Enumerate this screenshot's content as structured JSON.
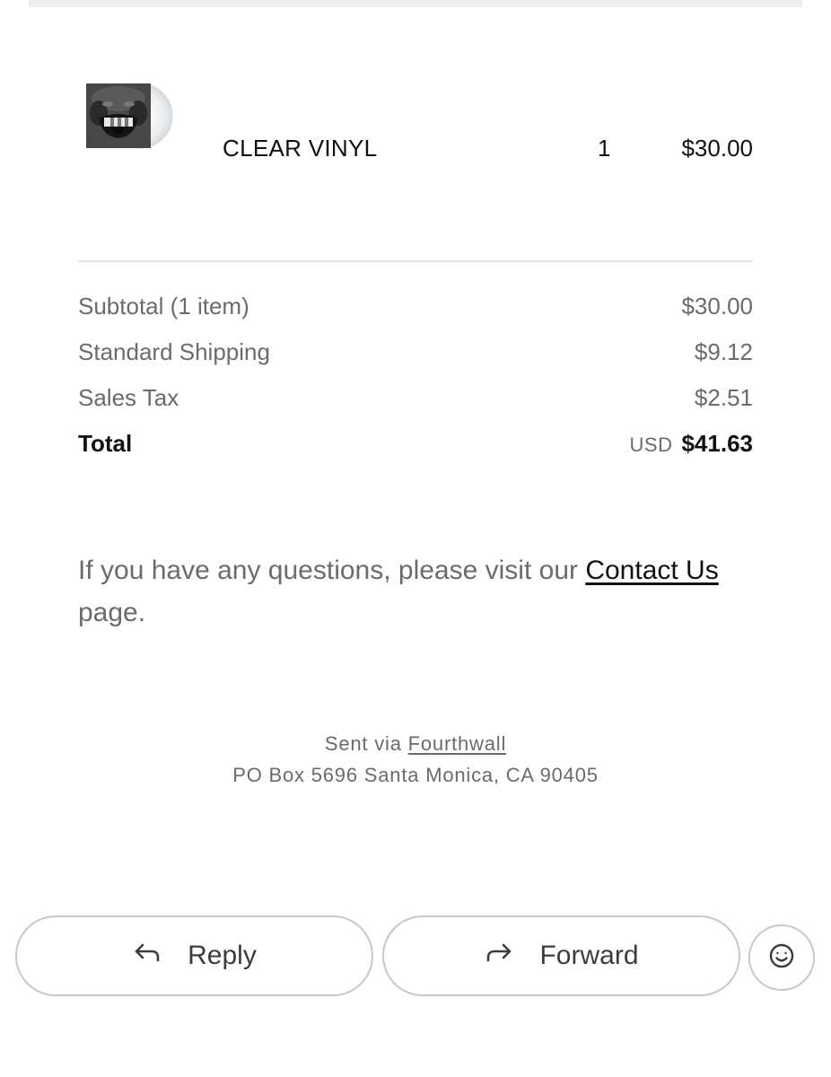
{
  "order": {
    "item": {
      "thumbnail_icon": "album-cover-clear-vinyl",
      "name": "CLEAR VINYL",
      "quantity": "1",
      "price": "$30.00"
    },
    "summary": {
      "subtotal_label": "Subtotal (1 item)",
      "subtotal_value": "$30.00",
      "shipping_label": "Standard Shipping",
      "shipping_value": "$9.12",
      "tax_label": "Sales Tax",
      "tax_value": "$2.51",
      "total_label": "Total",
      "total_currency": "USD",
      "total_value": "$41.63"
    }
  },
  "questions": {
    "text_before": "If you have any questions, please visit our ",
    "link_text": "Contact Us",
    "text_after": " page."
  },
  "footer": {
    "sent_via_label": "Sent via ",
    "brand_link": "Fourthwall",
    "address": "PO Box 5696 Santa Monica, CA 90405"
  },
  "actions": {
    "reply_label": "Reply",
    "reply_icon": "reply-arrow-icon",
    "forward_label": "Forward",
    "forward_icon": "forward-arrow-icon",
    "emoji_icon": "smiley-icon"
  },
  "colors": {
    "text_primary": "#111111",
    "text_secondary": "#6b6b6b",
    "divider": "#e3e3e3",
    "button_border": "#c8c8c8"
  }
}
